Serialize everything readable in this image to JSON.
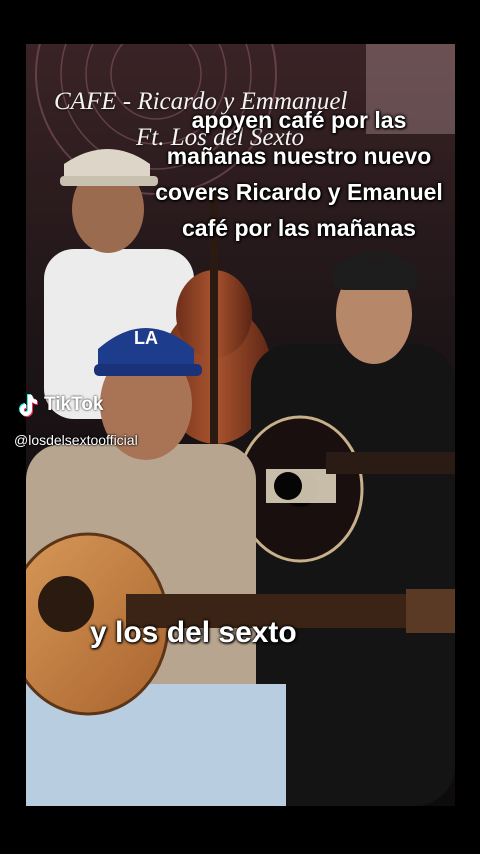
{
  "video": {
    "title_line1": "CAFE - Ricardo y Emmanuel",
    "title_line2": "Ft. Los del Sexto",
    "caption": "apoyen café por las mañanas nuestro nuevo covers Ricardo y Emanuel café por las mañanas",
    "bottom_caption": "y los del sexto",
    "cap_logo_text": "LA"
  },
  "watermark": {
    "brand": "TikTok",
    "handle": "@losdelsextoofficial"
  }
}
